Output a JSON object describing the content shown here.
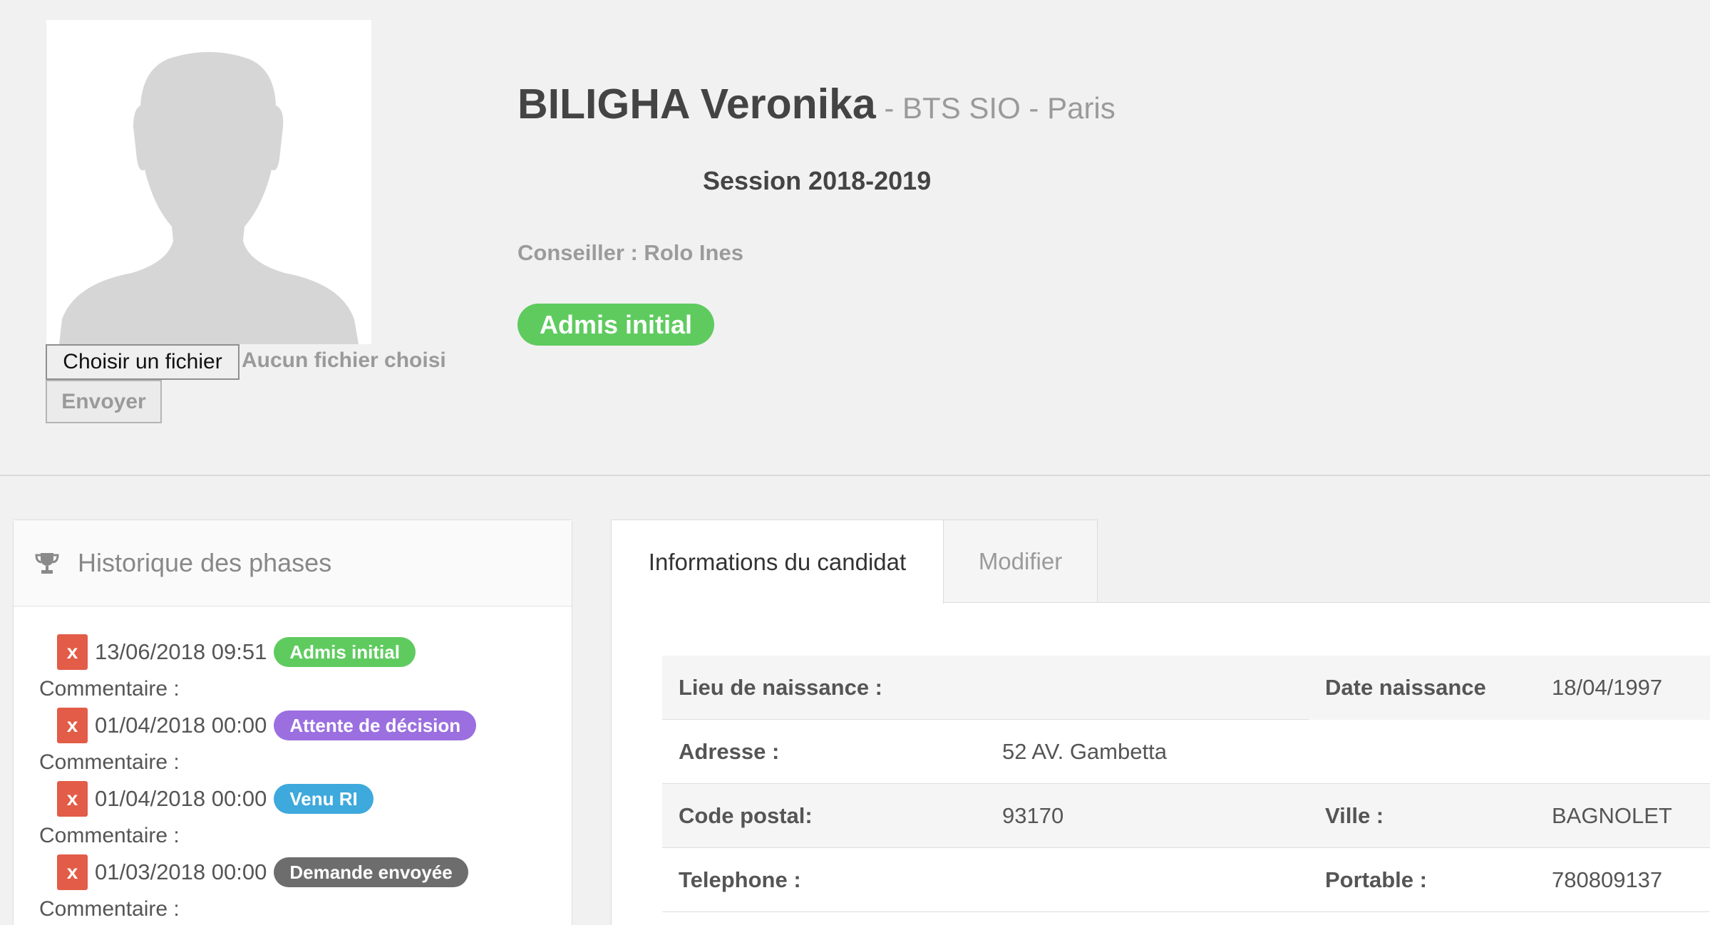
{
  "profile": {
    "photo_alt": "avatar placeholder",
    "choose_file_label": "Choisir un fichier",
    "file_status": "Aucun fichier choisi",
    "send_label": "Envoyer",
    "name": "BILIGHA Veronika",
    "program": " - BTS SIO - Paris",
    "session": "Session 2018-2019",
    "advisor": "Conseiller : Rolo Ines",
    "status": "Admis initial",
    "status_color": "#5fcb5f"
  },
  "history": {
    "title": "Historique des phases",
    "icon": "trophy-icon",
    "comment_label": "Commentaire :",
    "entries": [
      {
        "remove": "x",
        "date": "13/06/2018 09:51",
        "phase": "Admis initial",
        "color": "#5fcb5f"
      },
      {
        "remove": "x",
        "date": "01/04/2018 00:00",
        "phase": "Attente de décision",
        "color": "#9b6fe0"
      },
      {
        "remove": "x",
        "date": "01/04/2018 00:00",
        "phase": "Venu RI",
        "color": "#3ea9dc"
      },
      {
        "remove": "x",
        "date": "01/03/2018 00:00",
        "phase": "Demande envoyée",
        "color": "#6d6d6d"
      }
    ]
  },
  "tabs": {
    "info": "Informations du candidat",
    "edit": "Modifier"
  },
  "info": {
    "birthplace_label": "Lieu de naissance :",
    "birthplace": "",
    "birthdate_label": "Date naissance",
    "birthdate": "18/04/1997",
    "address_label": "Adresse :",
    "address": "52 AV. Gambetta",
    "postcode_label": "Code postal:",
    "postcode": "93170",
    "city_label": "Ville :",
    "city": "BAGNOLET",
    "phone_label": "Telephone :",
    "phone": "",
    "mobile_label": "Portable :",
    "mobile": "780809137"
  }
}
